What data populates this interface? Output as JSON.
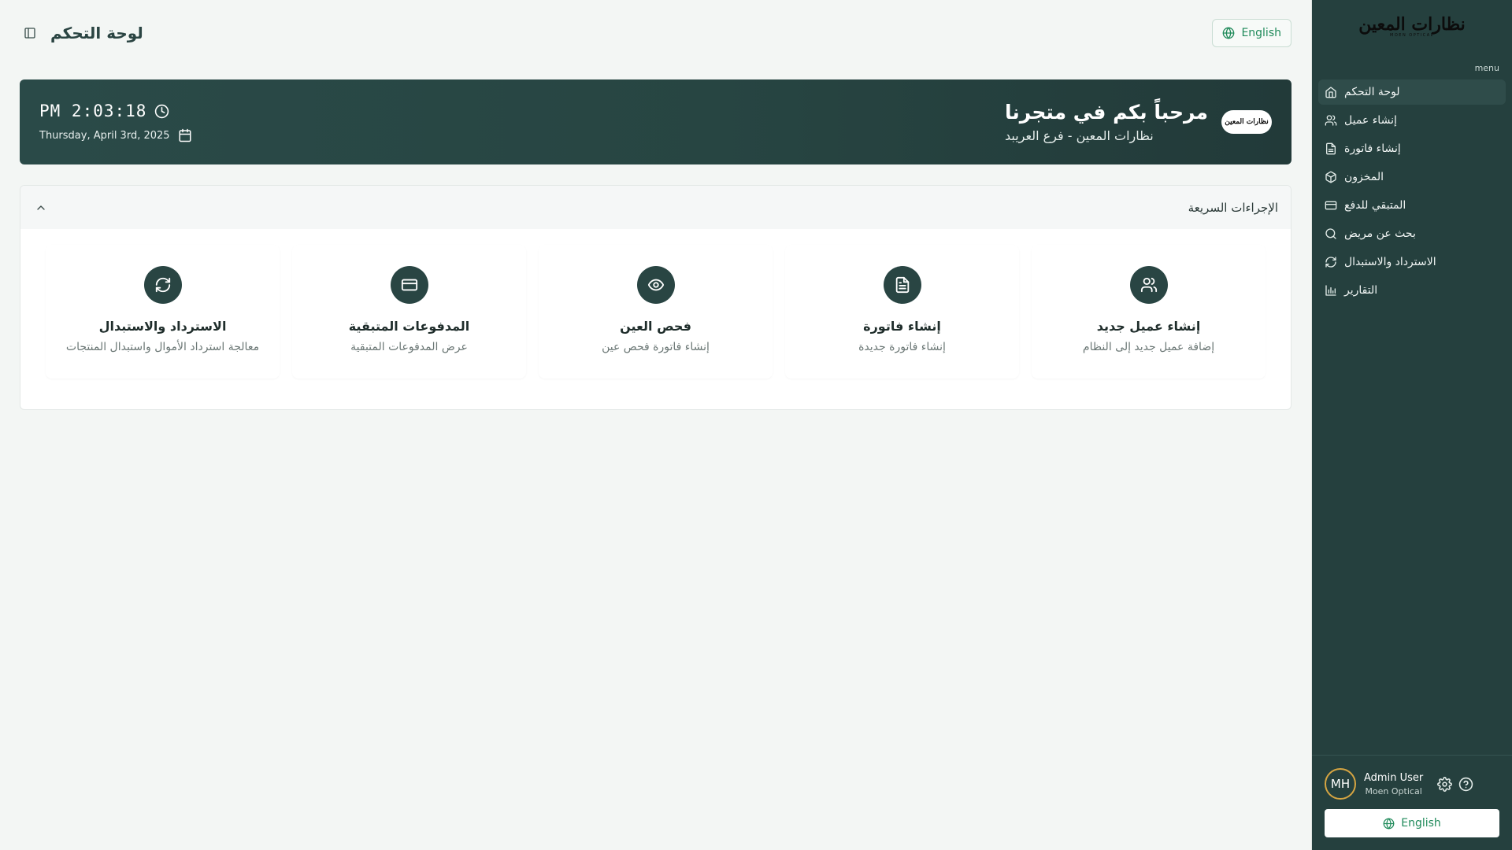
{
  "header": {
    "page_title": "لوحة التحكم",
    "language_button": "English"
  },
  "hero": {
    "title": "مرحباً بكم في متجرنا",
    "subtitle": "نظارات المعين - فرع العريبد",
    "time": "PM 2:03:18",
    "date": "Thursday, April 3rd, 2025",
    "logo_text": "نظارات المعين"
  },
  "quick_actions": {
    "title": "الإجراءات السريعة",
    "items": [
      {
        "label": "إنشاء عميل جديد",
        "desc": "إضافة عميل جديد إلى النظام",
        "icon": "users-icon"
      },
      {
        "label": "إنشاء فاتورة",
        "desc": "إنشاء فاتورة جديدة",
        "icon": "file-text-icon"
      },
      {
        "label": "فحص العين",
        "desc": "إنشاء فاتورة فحص عين",
        "icon": "eye-icon"
      },
      {
        "label": "المدفوعات المتبقية",
        "desc": "عرض المدفوعات المتبقية",
        "icon": "credit-card-icon"
      },
      {
        "label": "الاسترداد والاستبدال",
        "desc": "معالجة استرداد الأموال واستبدال المنتجات",
        "icon": "refresh-icon"
      }
    ]
  },
  "sidebar": {
    "logo_text": "نظارات المعين",
    "logo_subtext": "MOEN OPTICAL",
    "menu_caption": "menu",
    "items": [
      {
        "label": "لوحة التحكم",
        "icon": "home-icon",
        "active": true
      },
      {
        "label": "إنشاء عميل",
        "icon": "users-icon",
        "active": false
      },
      {
        "label": "إنشاء فاتورة",
        "icon": "file-text-icon",
        "active": false
      },
      {
        "label": "المخزون",
        "icon": "package-icon",
        "active": false
      },
      {
        "label": "المتبقي للدفع",
        "icon": "credit-card-icon",
        "active": false
      },
      {
        "label": "بحث عن مريض",
        "icon": "search-icon",
        "active": false
      },
      {
        "label": "الاسترداد والاستبدال",
        "icon": "refresh-icon",
        "active": false
      },
      {
        "label": "التقارير",
        "icon": "bar-chart-icon",
        "active": false
      }
    ],
    "user": {
      "initials": "MH",
      "name": "Admin User",
      "org": "Moen Optical"
    },
    "language_button": "English"
  },
  "colors": {
    "primary": "#294543",
    "accent_green": "#1f8a5a",
    "avatar_ring": "#d6a542",
    "background": "#f3f6f4"
  }
}
